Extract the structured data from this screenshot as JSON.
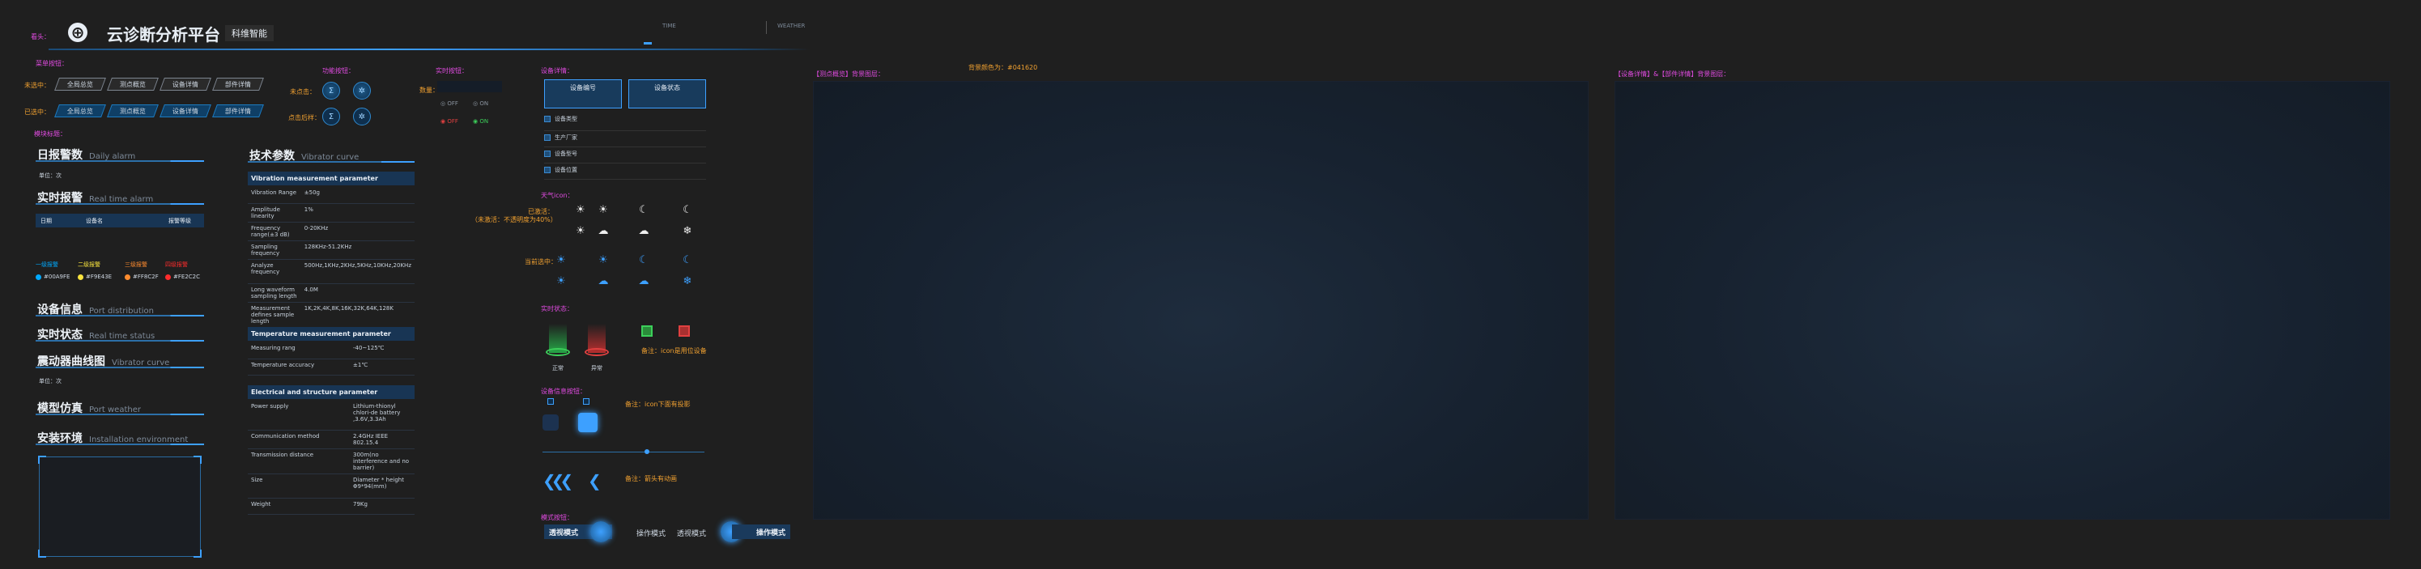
{
  "top": {
    "label": "看头：",
    "logo_glyph": "⊕",
    "title": "云诊断分析平台",
    "subtitle": "科维智能",
    "time": "TIME",
    "weather": "WEATHER"
  },
  "nav": {
    "section_label": "菜单按钮：",
    "row_unselected_label": "未选中：",
    "row_selected_label": "已选中：",
    "tabs": [
      "全局总览",
      "测点概览",
      "设备详情",
      "部件详情"
    ]
  },
  "function_buttons": {
    "title": "功能按钮：",
    "unselected_label": "未点击：",
    "selected_label": "点击后样：",
    "icons": [
      "Σ",
      "✲"
    ]
  },
  "realtime_monitor": {
    "title": "实时按钮：",
    "field_label": "数量：",
    "off": "OFF",
    "on": "ON"
  },
  "sidebar": {
    "module_label": "模块标题：",
    "daily_alarm": {
      "cn": "日报警数",
      "en": "Daily alarm"
    },
    "unit_1": "单位：次",
    "realtime_alarm": {
      "cn": "实时报警",
      "en": "Real time alarm"
    },
    "alarm_table_headers": [
      "日期",
      "设备名",
      "报警等级"
    ],
    "alarm_levels": [
      {
        "name": "一级报警",
        "color_label": "#00A9FE",
        "color": "#00A9FE"
      },
      {
        "name": "二级报警",
        "color_label": "#F9E43E",
        "color": "#F9E43E"
      },
      {
        "name": "三级报警",
        "color_label": "#FF8C2F",
        "color": "#FF8C2F"
      },
      {
        "name": "四级报警",
        "color_label": "#FE2C2C",
        "color": "#FE2C2C"
      }
    ],
    "device_info": {
      "cn": "设备信息",
      "en": "Port distribution"
    },
    "realtime_status": {
      "cn": "实时状态",
      "en": "Real time status"
    },
    "vibration_curve": {
      "cn": "震动器曲线图",
      "en": "Vibrator curve"
    },
    "unit_2": "单位：次",
    "model_sim": {
      "cn": "模型仿真",
      "en": "Port weather"
    },
    "install_env": {
      "cn": "安装环境",
      "en": "Installation environment"
    }
  },
  "tech": {
    "title": {
      "cn": "技术参数",
      "en": "Vibrator curve"
    },
    "sections": [
      {
        "name": "Vibration measurement parameter",
        "rows": [
          [
            "Vibration Range",
            "±50g"
          ],
          [
            "Amplitude linearity",
            "1%"
          ],
          [
            "Frequency range(±3 dB)",
            "0-20KHz"
          ],
          [
            "Sampling frequency",
            "128KHz-51.2KHz"
          ],
          [
            "Analyze frequency",
            "500Hz,1KHz,2KHz,5KHz,10KHz,20KHz"
          ],
          [
            "Long waveform sampling length",
            "4.0M"
          ],
          [
            "Measurement defines sample length",
            "1K,2K,4K,8K,16K,32K,64K,128K"
          ]
        ]
      },
      {
        "name": "Temperature measurement parameter",
        "rows": [
          [
            "Measuring rang",
            "-40~125℃"
          ],
          [
            "Temperature accuracy",
            "±1℃"
          ]
        ]
      },
      {
        "name": "Electrical and structure parameter",
        "rows": [
          [
            "Power supply",
            "Lithium-thionyl chlori-de battery ,3.6V,3.3Ah"
          ],
          [
            "Communication method",
            "2.4GHz IEEE 802.15.4"
          ],
          [
            "Transmission distance",
            "300m(no interference and no barrier)"
          ],
          [
            "Size",
            "Diameter * height Φ9*94(mm)"
          ],
          [
            "Weight",
            "79Kg"
          ]
        ]
      }
    ]
  },
  "device_detail": {
    "title": "设备详情：",
    "tabs": [
      "设备编号",
      "设备状态"
    ],
    "items": [
      "设备类型",
      "生产厂家",
      "设备型号",
      "设备位置"
    ]
  },
  "weather_icons": {
    "title": "天气icon：",
    "unselected_label": "已激活：",
    "unselected_note": "（未激活：不透明度为40%）",
    "selected_label": "当前选中：",
    "icons": [
      "☀",
      "☀",
      "☾",
      "☾",
      "☀",
      "☁",
      "☁",
      "❄"
    ]
  },
  "realtime_status_icons": {
    "title": "实时状态：",
    "normal": "正常",
    "abnormal": "异常",
    "note": "备注：icon是用位设备"
  },
  "device_toggle": {
    "title": "设备信息按钮：",
    "note": "备注：icon下面有投影"
  },
  "arrows": {
    "note": "备注：箭头有动画"
  },
  "mode_buttons": {
    "title": "模式按钮：",
    "left": {
      "a": "透视模式",
      "b": "操作模式"
    },
    "right": {
      "a": "透视模式",
      "b": "操作模式"
    }
  },
  "panels": {
    "left_title": "【测点概览】背景图层：",
    "bg_color_label": "背景颜色为：#041620",
    "right_title": "【设备详情】&【部件详情】背景图层："
  },
  "colors": {
    "accent": "#3da0ff",
    "magenta": "#e04be0",
    "orange": "#f0a030"
  }
}
